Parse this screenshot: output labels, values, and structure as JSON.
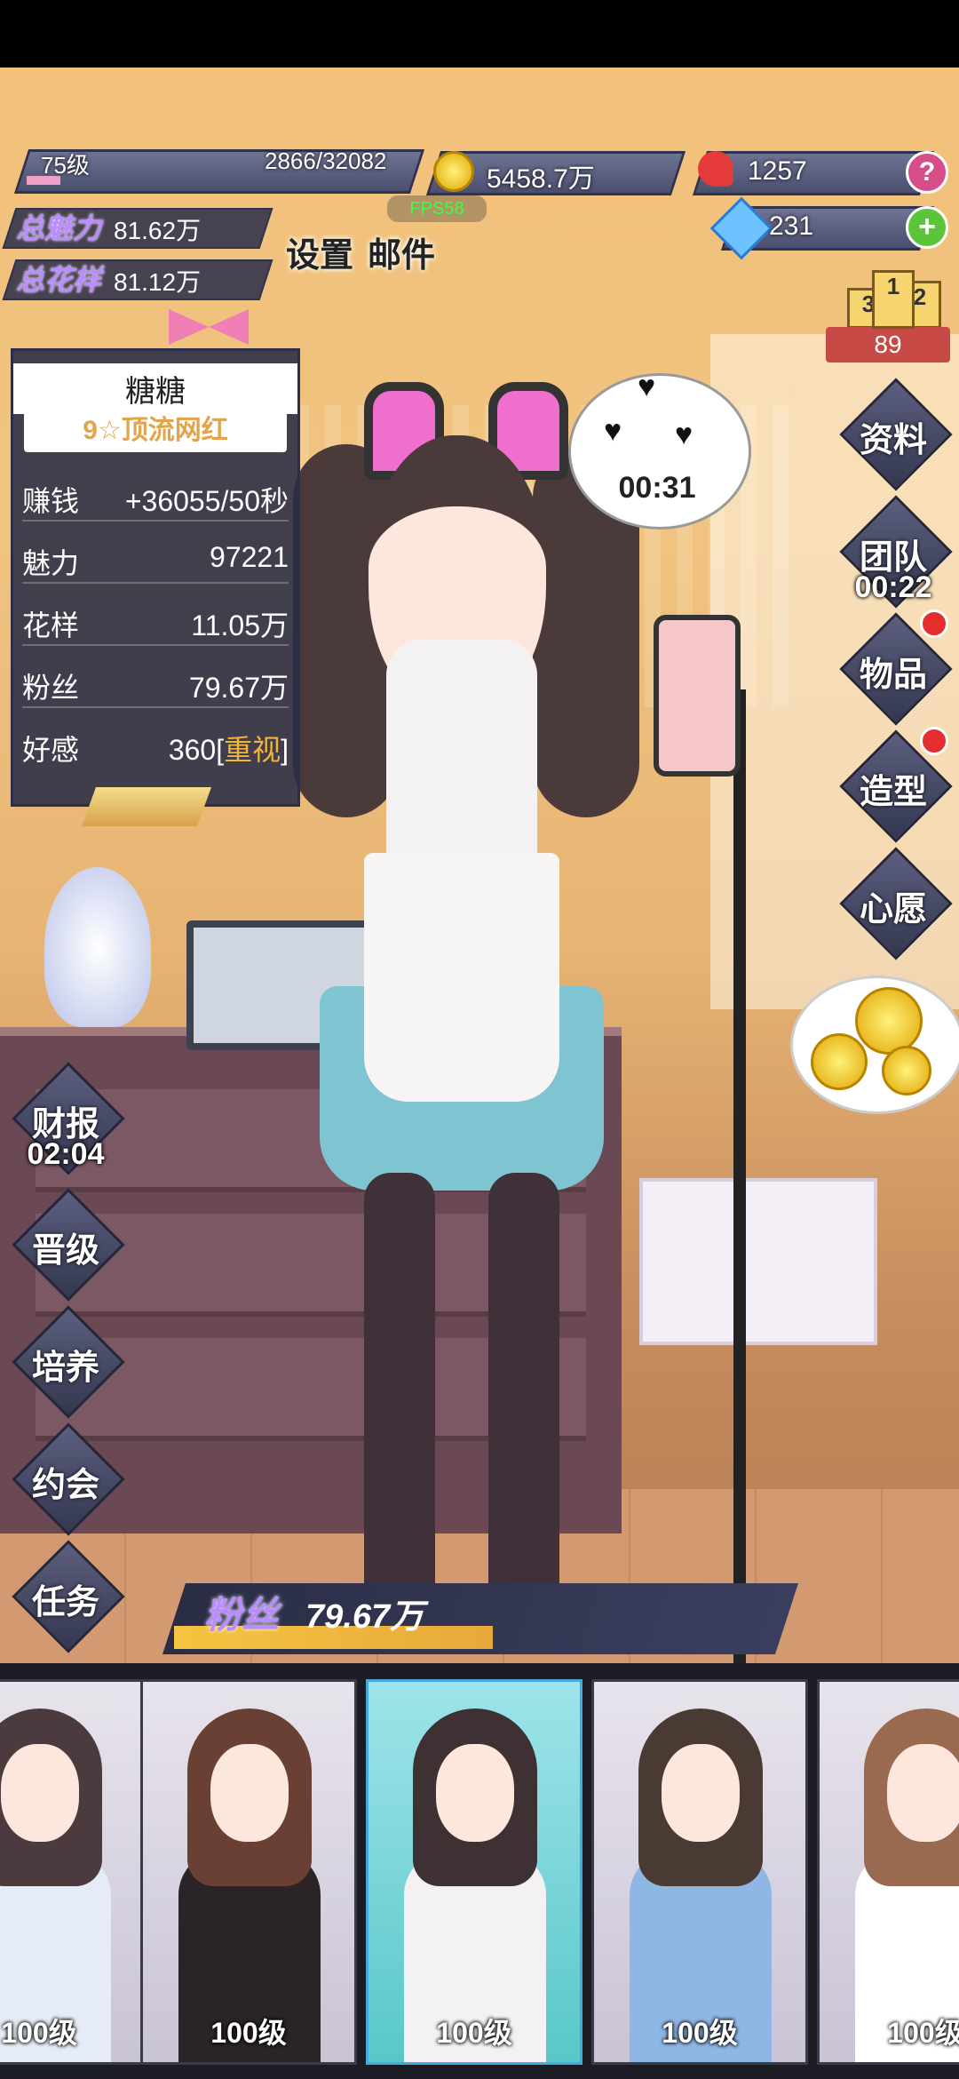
{
  "hud": {
    "level": "75级",
    "exp": "2866/32082",
    "exp_fraction": 0.089,
    "gold": "5458.7万",
    "roses": "1257",
    "diamonds": "231",
    "small_tag": "FPS58",
    "total_charm_label": "总魅力",
    "total_charm_value": "81.62万",
    "total_style_label": "总花样",
    "total_style_value": "81.12万",
    "settings_label": "设置",
    "mail_label": "邮件",
    "rank_1": "1",
    "rank_2": "2",
    "rank_3": "3",
    "rank_value": "89"
  },
  "panel": {
    "name": "糖糖",
    "title": "9☆顶流网红",
    "rows": [
      {
        "label": "赚钱",
        "value": "+36055/50秒"
      },
      {
        "label": "魅力",
        "value": "97221"
      },
      {
        "label": "花样",
        "value": "11.05万"
      },
      {
        "label": "粉丝",
        "value": "79.67万"
      },
      {
        "label": "好感",
        "value_prefix": "360[",
        "value_highlight": "重视",
        "value_suffix": "]"
      }
    ]
  },
  "right_menu": {
    "profile": "资料",
    "team": "团队",
    "team_timer": "00:22",
    "items": "物品",
    "style": "造型",
    "wish": "心愿"
  },
  "left_menu": {
    "finance": "财报",
    "finance_timer": "02:04",
    "promote": "晋级",
    "train": "培养",
    "date": "约会",
    "task": "任务"
  },
  "bubble": {
    "timer": "00:31"
  },
  "fans_bar": {
    "label": "粉丝",
    "value": "79.67万",
    "fraction": 0.52
  },
  "carousel": [
    {
      "level": "100级",
      "hair": "#4b3a3e",
      "outfit": "#e6ecf7",
      "selected": false
    },
    {
      "level": "100级",
      "hair": "#6a3f34",
      "outfit": "#2b2426",
      "selected": false
    },
    {
      "level": "100级",
      "hair": "#3f3034",
      "outfit": "#f3f1f2",
      "selected": true
    },
    {
      "level": "100级",
      "hair": "#4a3a34",
      "outfit": "#8fb7e4",
      "selected": false
    },
    {
      "level": "100级",
      "hair": "#9a6a50",
      "outfit": "#ffffff",
      "selected": false
    }
  ],
  "colors": {
    "accent_purple": "#ba8cff",
    "gold": "#f0b53a",
    "badge_red": "#e42d2d"
  }
}
